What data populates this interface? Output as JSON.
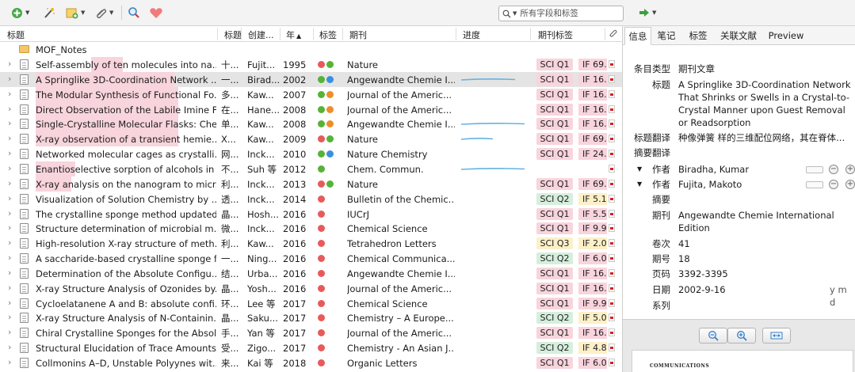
{
  "toolbar": {
    "search_placeholder": "所有字段和标签",
    "icons": [
      "new-item-icon",
      "magic-wand-icon",
      "new-note-icon",
      "attachment-icon",
      "search-icon",
      "tag-heart-icon",
      "sync-arrow-icon"
    ]
  },
  "colors": {
    "selected_row": "#e4e4e4",
    "title_highlight": "#f8d4dd",
    "dot_red": "#e85a5a",
    "dot_green": "#55b335",
    "dot_blue": "#3b8ee0",
    "dot_orange": "#ef8d2a",
    "sci_q1_bg": "#f8d4dd",
    "sci_q2_bg": "#d6efdd",
    "sci_q3_bg": "#fdf0c8",
    "if_high_bg": "#f8d4dd",
    "if_low_bg": "#fdf0c8",
    "progress_blue": "#64b3e0"
  },
  "columns": {
    "title": "标题",
    "extra": "标题",
    "creator": "创建...",
    "year": "年",
    "tags": "标签",
    "journal": "期刊",
    "progress": "进度",
    "jtags": "期刊标签"
  },
  "collection": {
    "name": "MOF_Notes"
  },
  "rows": [
    {
      "title": "Self-assembly of ten molecules into na...",
      "extra": "十...",
      "creator": "Fujit...",
      "year": "1995",
      "dots": [
        "red",
        "green"
      ],
      "journal": "Nature",
      "progress": null,
      "sci": "SCI Q1",
      "if": "IF 69...",
      "hl": [
        115,
        155
      ],
      "sel": false
    },
    {
      "title": "A Springlike 3D-Coordination Network ...",
      "extra": "一...",
      "creator": "Birad...",
      "year": "2002",
      "dots": [
        "green",
        "blue"
      ],
      "journal": "Angewandte Chemie I...",
      "progress": 0.85,
      "sci": "SCI Q1",
      "if": "IF 16...",
      "hl": [
        45,
        220
      ],
      "sel": true
    },
    {
      "title": "The Modular Synthesis of Functional Fo...",
      "extra": "多...",
      "creator": "Kaw...",
      "year": "2007",
      "dots": [
        "green",
        "orange"
      ],
      "journal": "Journal of the Americ...",
      "progress": null,
      "sci": "SCI Q1",
      "if": "IF 16...",
      "hl": [
        45,
        225
      ],
      "sel": false
    },
    {
      "title": "Direct Observation of the Labile Imine F...",
      "extra": "在...",
      "creator": "Hane...",
      "year": "2008",
      "dots": [
        "green",
        "orange"
      ],
      "journal": "Journal of the Americ...",
      "progress": null,
      "sci": "SCI Q1",
      "if": "IF 16...",
      "hl": [
        45,
        225
      ],
      "sel": false
    },
    {
      "title": "Single-Crystalline Molecular Flasks: Che...",
      "extra": "单...",
      "creator": "Kaw...",
      "year": "2008",
      "dots": [
        "green",
        "orange"
      ],
      "journal": "Angewandte Chemie I...",
      "progress": 1.0,
      "sci": "SCI Q1",
      "if": "IF 16...",
      "hl": [
        45,
        225
      ],
      "sel": false
    },
    {
      "title": "X-ray observation of a transient hemie...",
      "extra": "X...",
      "creator": "Kaw...",
      "year": "2009",
      "dots": [
        "red",
        "green"
      ],
      "journal": "Nature",
      "progress": 0.5,
      "sci": "SCI Q1",
      "if": "IF 69...",
      "hl": [
        45,
        225
      ],
      "sel": false
    },
    {
      "title": "Networked molecular cages as crystalli...",
      "extra": "网...",
      "creator": "Inck...",
      "year": "2010",
      "dots": [
        "green",
        "blue"
      ],
      "journal": "Nature Chemistry",
      "progress": null,
      "sci": "SCI Q1",
      "if": "IF 24...",
      "hl": null,
      "sel": false
    },
    {
      "title": "Enantioselective sorption of alcohols in ...",
      "extra": "不...",
      "creator": "Suh 等",
      "year": "2012",
      "dots": [
        "green"
      ],
      "journal": "Chem. Commun.",
      "progress": 1.0,
      "sci": "",
      "if": "",
      "hl": [
        45,
        95
      ],
      "sel": false
    },
    {
      "title": "X-ray analysis on the nanogram to micr...",
      "extra": "利...",
      "creator": "Inck...",
      "year": "2013",
      "dots": [
        "red",
        "green"
      ],
      "journal": "Nature",
      "progress": null,
      "sci": "SCI Q1",
      "if": "IF 69...",
      "hl": [
        45,
        90
      ],
      "sel": false
    },
    {
      "title": "Visualization of Solution Chemistry by ...",
      "extra": "透...",
      "creator": "Inck...",
      "year": "2014",
      "dots": [
        "red"
      ],
      "journal": "Bulletin of the Chemic...",
      "progress": null,
      "sci": "SCI Q2",
      "if": "IF 5.1...",
      "hl": null,
      "sel": false
    },
    {
      "title": "The crystalline sponge method updated",
      "extra": "晶...",
      "creator": "Hosh...",
      "year": "2016",
      "dots": [
        "red"
      ],
      "journal": "IUCrJ",
      "progress": null,
      "sci": "SCI Q1",
      "if": "IF 5.5...",
      "hl": null,
      "sel": false
    },
    {
      "title": "Structure determination of microbial m...",
      "extra": "微...",
      "creator": "Inck...",
      "year": "2016",
      "dots": [
        "red"
      ],
      "journal": "Chemical Science",
      "progress": null,
      "sci": "SCI Q1",
      "if": "IF 9.9...",
      "hl": null,
      "sel": false
    },
    {
      "title": "High-resolution X-ray structure of meth...",
      "extra": "利...",
      "creator": "Kaw...",
      "year": "2016",
      "dots": [
        "red"
      ],
      "journal": "Tetrahedron Letters",
      "progress": null,
      "sci": "SCI Q3",
      "if": "IF 2.0...",
      "hl": null,
      "sel": false
    },
    {
      "title": "A saccharide-based crystalline sponge f...",
      "extra": "一...",
      "creator": "Ning...",
      "year": "2016",
      "dots": [
        "red"
      ],
      "journal": "Chemical Communica...",
      "progress": null,
      "sci": "SCI Q2",
      "if": "IF 6.0...",
      "hl": null,
      "sel": false
    },
    {
      "title": "Determination of the Absolute Configu...",
      "extra": "结...",
      "creator": "Urba...",
      "year": "2016",
      "dots": [
        "red"
      ],
      "journal": "Angewandte Chemie I...",
      "progress": null,
      "sci": "SCI Q1",
      "if": "IF 16...",
      "hl": null,
      "sel": false
    },
    {
      "title": "X-ray Structure Analysis of Ozonides by...",
      "extra": "晶...",
      "creator": "Yosh...",
      "year": "2016",
      "dots": [
        "red"
      ],
      "journal": "Journal of the Americ...",
      "progress": null,
      "sci": "SCI Q1",
      "if": "IF 16...",
      "hl": null,
      "sel": false
    },
    {
      "title": "Cycloelatanene A and B: absolute confi...",
      "extra": "环...",
      "creator": "Lee 等",
      "year": "2017",
      "dots": [
        "red"
      ],
      "journal": "Chemical Science",
      "progress": null,
      "sci": "SCI Q1",
      "if": "IF 9.9...",
      "hl": null,
      "sel": false
    },
    {
      "title": "X-ray Structure Analysis of N-Containin...",
      "extra": "晶...",
      "creator": "Saku...",
      "year": "2017",
      "dots": [
        "red"
      ],
      "journal": "Chemistry – A Europe...",
      "progress": null,
      "sci": "SCI Q2",
      "if": "IF 5.0...",
      "hl": null,
      "sel": false
    },
    {
      "title": "Chiral Crystalline Sponges for the Absol...",
      "extra": "手...",
      "creator": "Yan 等",
      "year": "2017",
      "dots": [
        "red"
      ],
      "journal": "Journal of the Americ...",
      "progress": null,
      "sci": "SCI Q1",
      "if": "IF 16...",
      "hl": null,
      "sel": false
    },
    {
      "title": "Structural Elucidation of Trace Amounts...",
      "extra": "受...",
      "creator": "Zigo...",
      "year": "2017",
      "dots": [
        "red"
      ],
      "journal": "Chemistry - An Asian J...",
      "progress": null,
      "sci": "SCI Q2",
      "if": "IF 4.8...",
      "hl": null,
      "sel": false
    },
    {
      "title": "Collmonins A–D, Unstable Polyynes wit...",
      "extra": "来...",
      "creator": "Kai 等",
      "year": "2018",
      "dots": [
        "red"
      ],
      "journal": "Organic Letters",
      "progress": null,
      "sci": "SCI Q1",
      "if": "IF 6.0...",
      "hl": null,
      "sel": false
    }
  ],
  "pane": {
    "tabs": [
      "信息",
      "笔记",
      "标签",
      "关联文献",
      "Preview"
    ],
    "fields": {
      "item_type_label": "条目类型",
      "item_type": "期刊文章",
      "title_label": "标题",
      "title": "A Springlike 3D-Coordination Network That Shrinks or Swells in a Crystal-to-Crystal Manner upon Guest Removal or Readsorption",
      "title_trans_label": "标题翻译",
      "title_trans": "种像弹簧 样的三维配位网络，其在脊体...",
      "abstract_trans_label": "摘要翻译",
      "author_label": "作者",
      "author1": "Biradha, Kumar",
      "author2": "Fujita, Makoto",
      "abstract_label": "摘要",
      "journal_label": "期刊",
      "journal": "Angewandte Chemie International Edition",
      "volume_label": "卷次",
      "volume": "41",
      "issue_label": "期号",
      "issue": "18",
      "pages_label": "页码",
      "pages": "3392-3395",
      "date_label": "日期",
      "date": "2002-9-16",
      "date_fmt": "y m d",
      "series_label": "系列"
    },
    "preview_heading": "COMMUNICATIONS"
  }
}
